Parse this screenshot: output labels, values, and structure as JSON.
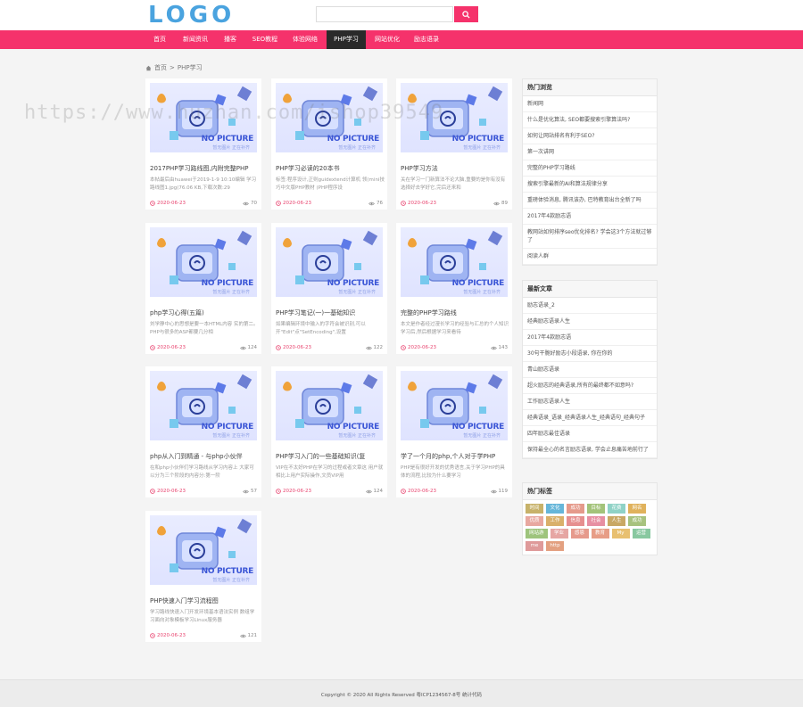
{
  "header": {
    "logo": "LOGO",
    "search_placeholder": ""
  },
  "nav": [
    {
      "label": "首页"
    },
    {
      "label": "新闻资讯"
    },
    {
      "label": "播客"
    },
    {
      "label": "SEO教程"
    },
    {
      "label": "体验网络"
    },
    {
      "label": "PHP学习",
      "active": true
    },
    {
      "label": "网站优化"
    },
    {
      "label": "励志语录"
    }
  ],
  "breadcrumb": {
    "home": "首页",
    "sep": ">",
    "current": "PHP学习"
  },
  "placeholder_image": {
    "text": "NO PICTURE",
    "subtext": "暂无图片 正在补齐"
  },
  "cards": [
    {
      "title": "2017PHP学习路线图,内附完整PHP",
      "excerpt": "本帖最后由huawei于2019-1-9 10:10编辑 学习路线图1.jpg(76.06 KB,下载次数:29",
      "date": "2020-06-23",
      "views": "70"
    },
    {
      "title": "PHP学习必读的20本书",
      "excerpt": "标签:程序设计,正则guidextend计算机 领(mini技巧中文版PHP教材 (PHP程序设",
      "date": "2020-06-23",
      "views": "76"
    },
    {
      "title": "PHP学习方法",
      "excerpt": "关在学习一门新算法不论大脑,重要的是你有没有选择好去学好它,完后还来和",
      "date": "2020-06-23",
      "views": "89"
    },
    {
      "title": "php学习心得(五篇)",
      "excerpt": "刘学静中心的思想是要一本HTML内容 实的第二。PHP与很多的ASP都要几分相",
      "date": "2020-06-23",
      "views": "124"
    },
    {
      "title": "PHP学习笔记(一)一基础知识",
      "excerpt": "如果编辑环境中输入的字符会被识别,可以开\"Edit\"点\"SetEncoding\",设置",
      "date": "2020-06-23",
      "views": "122"
    },
    {
      "title": "完整的PHP学习路线",
      "excerpt": "本文是作者经过漫长学习的经验与汇总的个人知识学习后,然后根据学习来看待",
      "date": "2020-06-23",
      "views": "143"
    },
    {
      "title": "php从入门到精通 - 与php小伙伴",
      "excerpt": "在和php小伙伴们学习路线从学习内容上 大家可以分为三个阶段的内容分:第一阶",
      "date": "2020-06-23",
      "views": "57"
    },
    {
      "title": "PHP学习入门的一些基础知识(复",
      "excerpt": "VIP在不太好PHP在学习的过程或者文章这 用户就相比上用户实际操作,文员VIP用",
      "date": "2020-06-23",
      "views": "124"
    },
    {
      "title": "学了一个月的php,个人对于学PHP",
      "excerpt": "PHP是有很好开发的优秀语言,关于学习PHP的具体的流程,比较为什么要学习",
      "date": "2020-06-23",
      "views": "119"
    },
    {
      "title": "PHP快速入门学习流程图",
      "excerpt": "学习路线快速入门开发环境基本语法实例 数组学习面向对象模板学习Linux服务器",
      "date": "2020-06-23",
      "views": "121"
    }
  ],
  "sidebar": {
    "hot_title": "热门浏览",
    "hot_items": [
      "新闻网",
      "什么是优化算法, SEO都要搜索引擎算法吗?",
      "如何让网站排名有利于SEO?",
      "第一次讲网",
      "完整的PHP学习路线",
      "搜索引擎最新的AI和算法规律分享",
      "重磅体验消息, 腾讯该办, 巴特教育出台全新了吗",
      "2017年4款励志语",
      "教网站如何排序seo优化排名? 学会这3个方法就过够了",
      "阅读人群"
    ],
    "latest_title": "最新文章",
    "latest_items": [
      "励志语录_2",
      "经典励志语录人生",
      "2017年4款励志语",
      "30句干脆好励志小段语录, 你在你的",
      "青山励志语录",
      "超火励志的经典语录,所有的最终都不如意吗?",
      "工作励志语录人生",
      "经典语录_语录_经典语录人生_经典语句_经典句子",
      "四年励志最佳语录",
      "保持最全心的名言励志语录, 学会止息痛苦地前行了"
    ],
    "tags_title": "热门标签",
    "tags": [
      {
        "label": "时间",
        "color": "#c7b26a"
      },
      {
        "label": "文化",
        "color": "#66b6d9"
      },
      {
        "label": "成功",
        "color": "#e59a8b"
      },
      {
        "label": "目标",
        "color": "#a3c37a"
      },
      {
        "label": "花费",
        "color": "#8fd2c6"
      },
      {
        "label": "网名",
        "color": "#e0b25c"
      },
      {
        "label": "优质",
        "color": "#e8a8a0"
      },
      {
        "label": "工作",
        "color": "#d9b06a"
      },
      {
        "label": "信息",
        "color": "#e68f8f"
      },
      {
        "label": "社会",
        "color": "#e78fa2"
      },
      {
        "label": "人生",
        "color": "#c9a864"
      },
      {
        "label": "成功",
        "color": "#a7c27e"
      },
      {
        "label": "网站游",
        "color": "#9ec47c"
      },
      {
        "label": "学业",
        "color": "#e6a6a3"
      },
      {
        "label": "感恩",
        "color": "#e69a8c"
      },
      {
        "label": "教育",
        "color": "#e79d86"
      },
      {
        "label": "My",
        "color": "#e8c070"
      },
      {
        "label": "运营",
        "color": "#88c8a0"
      },
      {
        "label": "me",
        "color": "#df9a9a"
      },
      {
        "label": "http",
        "color": "#e3a080"
      }
    ]
  },
  "footer": {
    "text": "Copyright © 2020 All Rights Reserved 粤ICP1234567-8号 统计代码"
  },
  "watermark": "https://www.huzhan.com/ishop39549"
}
